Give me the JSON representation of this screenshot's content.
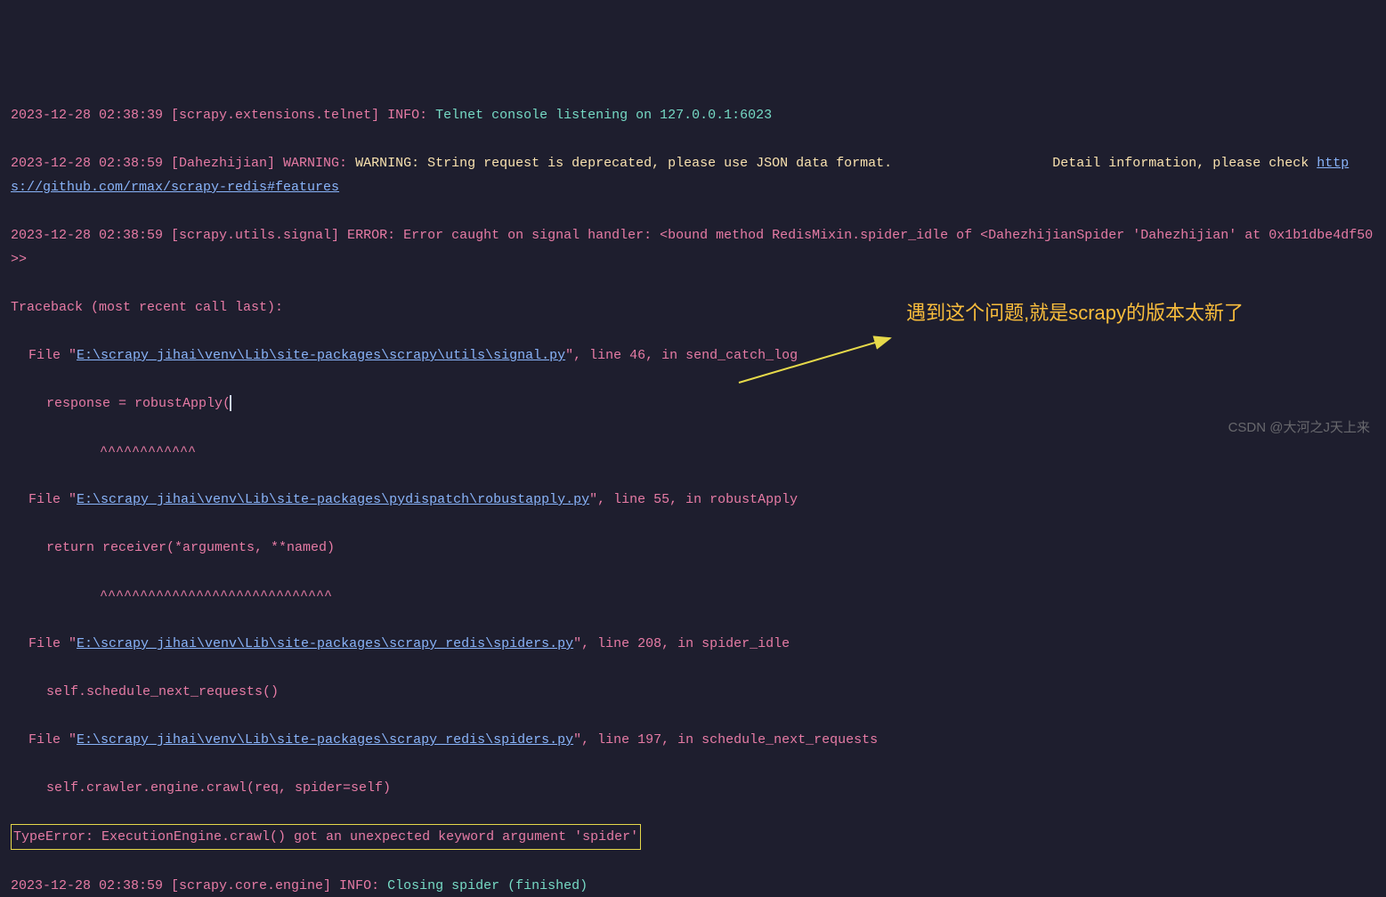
{
  "lines": {
    "l1_ts": "2023-12-28 02:38:39 [scrapy.extensions.telnet] INFO: ",
    "l1_msg": "Telnet console listening on 127.0.0.1:6023",
    "l2_ts": "2023-12-28 02:38:59 [Dahezhijian] WARNING: ",
    "l2_msg": "WARNING: String request is deprecated, please use JSON data format.                    Detail information, please check ",
    "l2_link": "https://github.com/rmax/scrapy-redis#features",
    "l3": "2023-12-28 02:38:59 [scrapy.utils.signal] ERROR: Error caught on signal handler: <bound method RedisMixin.spider_idle of <DahezhijianSpider 'Dahezhijian' at 0x1b1dbe4df50>>",
    "l4": "Traceback (most recent call last):",
    "l5_pre": "File \"",
    "l5_link": "E:\\scrapy_jihai\\venv\\Lib\\site-packages\\scrapy\\utils\\signal.py",
    "l5_post": "\", line 46, in send_catch_log",
    "l6": "response = robustApply(",
    "l7": "^^^^^^^^^^^^",
    "l8_pre": "File \"",
    "l8_link": "E:\\scrapy_jihai\\venv\\Lib\\site-packages\\pydispatch\\robustapply.py",
    "l8_post": "\", line 55, in robustApply",
    "l9": "return receiver(*arguments, **named)",
    "l10": "^^^^^^^^^^^^^^^^^^^^^^^^^^^^^",
    "l11_pre": "File \"",
    "l11_link": "E:\\scrapy_jihai\\venv\\Lib\\site-packages\\scrapy_redis\\spiders.py",
    "l11_post": "\", line 208, in spider_idle",
    "l12": "self.schedule_next_requests()",
    "l13_pre": "File \"",
    "l13_link": "E:\\scrapy_jihai\\venv\\Lib\\site-packages\\scrapy_redis\\spiders.py",
    "l13_post": "\", line 197, in schedule_next_requests",
    "l14": "self.crawler.engine.crawl(req, spider=self)",
    "l15": "TypeError: ExecutionEngine.crawl() got an unexpected keyword argument 'spider'",
    "l16_ts": "2023-12-28 02:38:59 [scrapy.core.engine] INFO: ",
    "l16_msg": "Closing spider (finished)"
  },
  "annotation": "遇到这个问题,就是scrapy的版本太新了",
  "watermark": "CSDN @大河之J天上来"
}
